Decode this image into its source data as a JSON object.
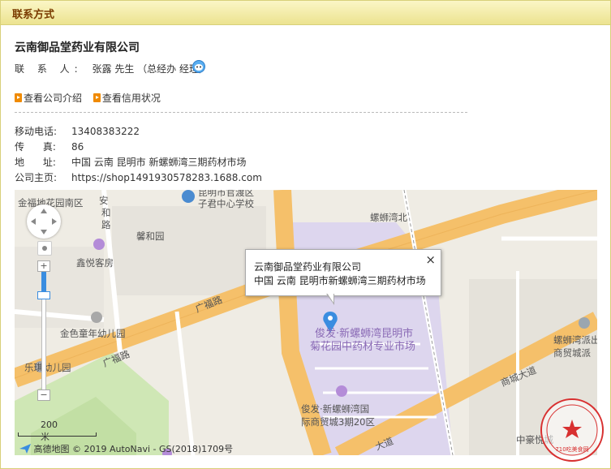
{
  "header": {
    "title": "联系方式"
  },
  "company": {
    "name": "云南御品堂药业有限公司"
  },
  "contact": {
    "label": "联 系 人:",
    "person": "张露 先生",
    "role": "（总经办 经理）",
    "im_icon": "wangwang-chat-icon"
  },
  "links": [
    {
      "label": "查看公司介绍",
      "icon": "orange-arrow-icon"
    },
    {
      "label": "查看信用状况",
      "icon": "orange-arrow-icon"
    }
  ],
  "info": {
    "mobile_label": "移动电话:",
    "mobile": "13408383222",
    "fax_label": "传      真:",
    "fax": "86",
    "address_label": "地      址:",
    "address": "中国 云南 昆明市 新螺蛳湾三期药材市场",
    "homepage_label": "公司主页:",
    "homepage": "https://shop1491930578283.1688.com"
  },
  "map": {
    "labels": {
      "area1": "金福地花园南区",
      "road_anhe1": "安",
      "road_anhe2": "和",
      "road_anhe3": "路",
      "school1": "昆明市官渡区",
      "school2": "子君中心学校",
      "xinhe": "馨和园",
      "hotel": "鑫悦客房",
      "luosi": "螺蛳湾北",
      "guangfu1": "广福路",
      "guangfu2": "广福路",
      "kinder": "金色童年幼儿园",
      "leqi": "乐琪幼儿园",
      "market1": "俊发·新螺蛳湾昆明市",
      "market2": "菊花园中药材专业市场",
      "junfa1": "俊发·新螺蛳湾国",
      "junfa2": "际商贸城3期20区",
      "shangcheng": "商城大道",
      "police1": "螺蛳湾派出",
      "police2": "商贸城派",
      "zhonghao": "中豪悦城",
      "dadao": "大道"
    },
    "scale": "200 米",
    "copyright": "高德地图 © 2019 AutoNavi - GS(2018)1709号",
    "popup": {
      "line1": "云南御品堂药业有限公司",
      "line2": "中国 云南 昆明市新螺蛳湾三期药材市场",
      "close": "×"
    },
    "zoom_in": "+",
    "zoom_out": "−",
    "accent": "#3a8de0",
    "road_color": "#f5c06a"
  },
  "stamp": {
    "text": "710吃美食网"
  }
}
